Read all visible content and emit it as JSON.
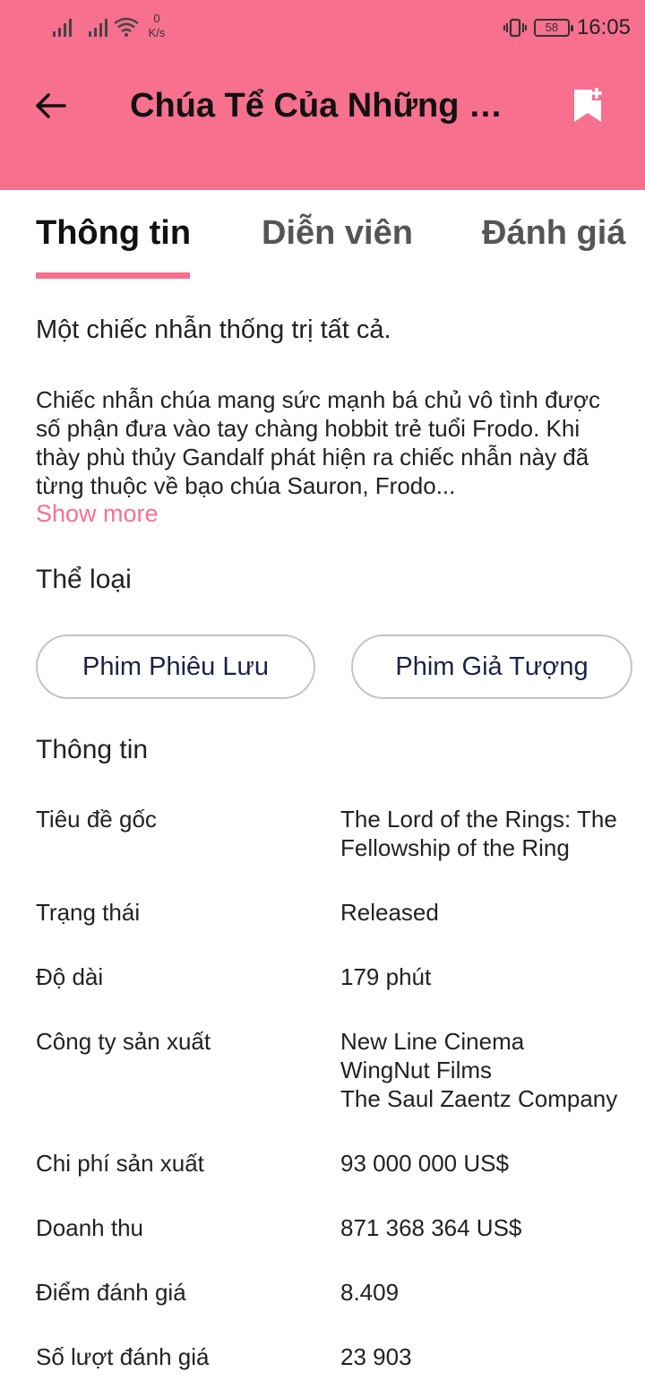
{
  "colors": {
    "accent": "#f7708e",
    "chip_text": "#1b2245",
    "chip_border": "#c4c4c4"
  },
  "status_bar": {
    "net_speed_value": "0",
    "net_speed_unit": "K/s",
    "battery": "58",
    "time": "16:05"
  },
  "toolbar": {
    "title": "Chúa Tể Của Những Chiếc Nhẫn: Hiệp Hội Nhẫn Thần",
    "back_icon": "arrow-left-icon",
    "bookmark_icon": "bookmark-add-icon"
  },
  "tabs": [
    {
      "label": "Thông tin",
      "active": true
    },
    {
      "label": "Diễn viên",
      "active": false
    },
    {
      "label": "Đánh giá",
      "active": false
    }
  ],
  "tagline": "Một chiếc nhẫn thống trị tất cả.",
  "overview": "Chiếc nhẫn chúa mang sức mạnh bá chủ vô tình được số phận đưa vào tay chàng hobbit trẻ tuổi Frodo. Khi thày phù thủy Gandalf phát hiện ra chiếc nhẫn này đã từng thuộc về bạo chúa Sauron, Frodo...",
  "show_more": "Show more",
  "genres": {
    "title": "Thể loại",
    "items": [
      "Phim Phiêu Lưu",
      "Phim Giả Tượng"
    ]
  },
  "info": {
    "title": "Thông tin",
    "rows": [
      {
        "label": "Tiêu đề gốc",
        "values": [
          "The Lord of the Rings: The",
          "Fellowship of the Ring"
        ]
      },
      {
        "label": "Trạng thái",
        "values": [
          "Released"
        ]
      },
      {
        "label": "Độ dài",
        "values": [
          "179 phút"
        ]
      },
      {
        "label": "Công ty sản xuất",
        "values": [
          "New Line Cinema",
          "WingNut Films",
          "The Saul Zaentz Company"
        ]
      },
      {
        "label": "Chi phí sản xuất",
        "values": [
          "93 000 000 US$"
        ]
      },
      {
        "label": "Doanh thu",
        "values": [
          "871 368 364 US$"
        ]
      },
      {
        "label": "Điểm đánh giá",
        "values": [
          "8.409"
        ]
      },
      {
        "label": "Số lượt đánh giá",
        "values": [
          "23 903"
        ]
      }
    ]
  }
}
